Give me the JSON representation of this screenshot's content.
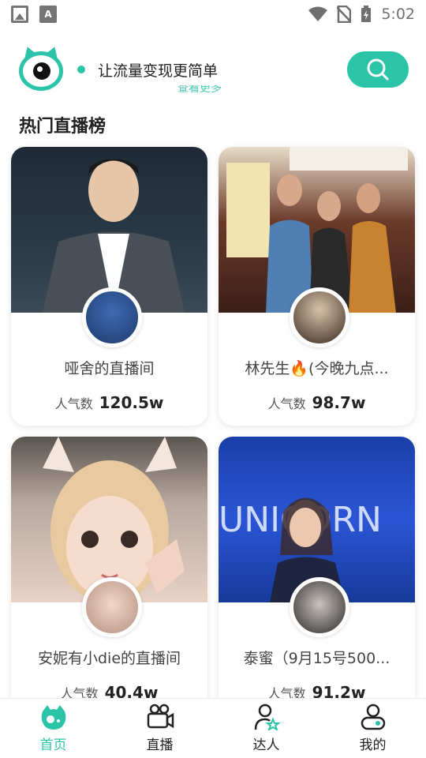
{
  "status_bar": {
    "time": "5:02"
  },
  "header": {
    "slogan": "让流量变现更简单",
    "view_more": "查看更多"
  },
  "section": {
    "title": "热门直播榜"
  },
  "cards": [
    {
      "name": "哑舍的直播间",
      "popularity_label": "人气数",
      "popularity": "120.5w"
    },
    {
      "name": "林先生🔥(今晚九点...",
      "popularity_label": "人气数",
      "popularity": "98.7w"
    },
    {
      "name": "安妮有小die的直播间",
      "popularity_label": "人气数",
      "popularity": "40.4w"
    },
    {
      "name": "泰蜜（9月15号500...",
      "popularity_label": "人气数",
      "popularity": "91.2w"
    }
  ],
  "nav": [
    {
      "label": "首页",
      "icon": "home-icon",
      "active": true
    },
    {
      "label": "直播",
      "icon": "camera-icon"
    },
    {
      "label": "达人",
      "icon": "star-user-icon"
    },
    {
      "label": "我的",
      "icon": "profile-icon"
    }
  ],
  "colors": {
    "accent": "#2cc4a8"
  }
}
